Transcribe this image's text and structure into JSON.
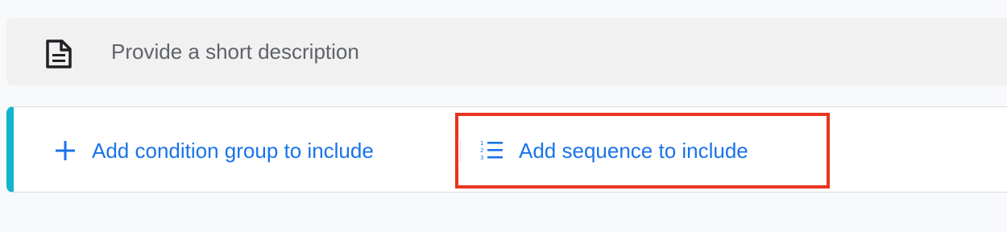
{
  "description_bar": {
    "icon": "document-icon",
    "placeholder": "Provide a short description",
    "value": ""
  },
  "actions": {
    "accent_color": "#12b5cb",
    "link_color": "#1a73e8",
    "add_condition_group": {
      "icon": "plus-icon",
      "label": "Add condition group to include"
    },
    "add_sequence": {
      "icon": "numbered-list-icon",
      "label": "Add sequence to include"
    }
  },
  "annotation": {
    "highlight_color": "#e8351f",
    "target": "add_sequence"
  }
}
